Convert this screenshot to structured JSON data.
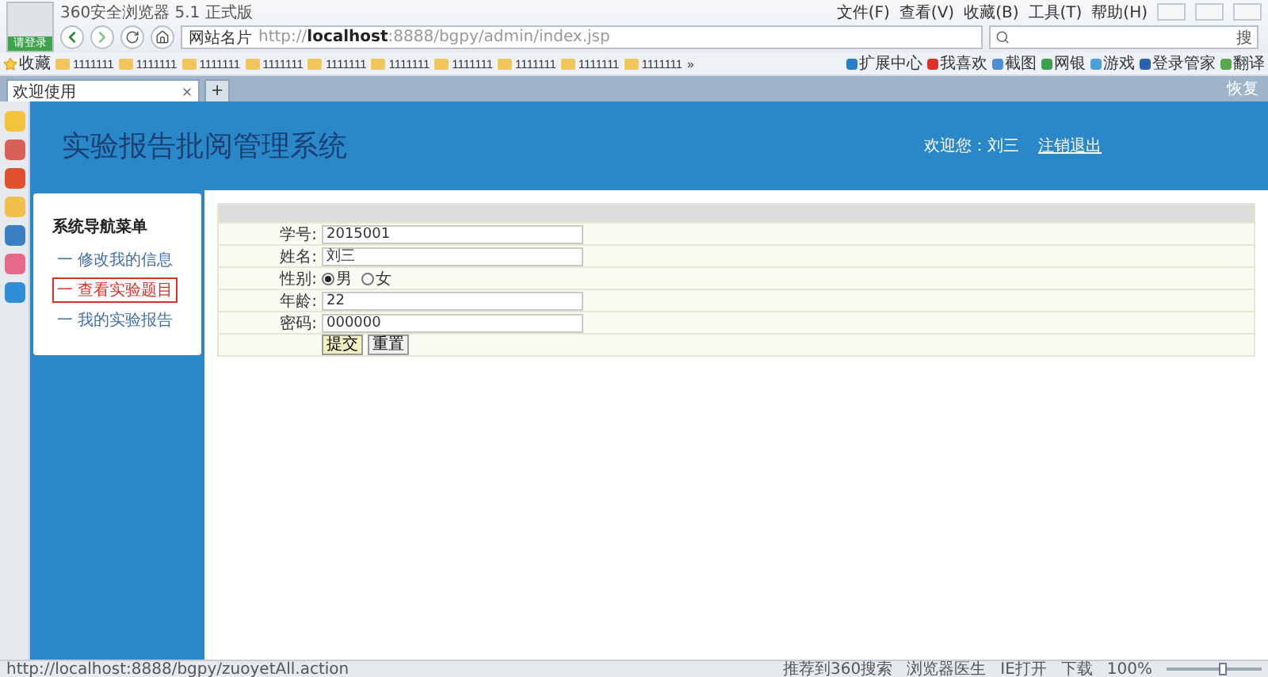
{
  "browser": {
    "title": "360安全浏览器 5.1 正式版",
    "login_label": "请登录",
    "menu": [
      "文件(F)",
      "查看(V)",
      "收藏(B)",
      "工具(T)",
      "帮助(H)"
    ],
    "site_name": "网站名片",
    "url_prefix": "http://",
    "url_host": "localhost",
    "url_rest": ":8888/bgpy/admin/index.jsp",
    "search_button": "搜",
    "favorites_label": "收藏",
    "bookmarks": [
      "1111111",
      "1111111",
      "1111111",
      "1111111",
      "1111111",
      "1111111",
      "1111111",
      "1111111",
      "1111111",
      "1111111"
    ],
    "more": "»",
    "tools": [
      "扩展中心",
      "我喜欢",
      "截图",
      "网银",
      "游戏",
      "登录管家",
      "翻译"
    ],
    "tabs": [
      {
        "label": "欢迎使用",
        "selected": true
      }
    ],
    "new_tab": "+",
    "restore_label": "恢复"
  },
  "page": {
    "title": "实验报告批阅管理系统",
    "welcome": "欢迎您：刘三",
    "logout": "注销退出",
    "nav": {
      "heading": "系统导航菜单",
      "items": [
        {
          "label": "一 修改我的信息",
          "selected": false
        },
        {
          "label": "一 查看实验题目",
          "selected": true
        },
        {
          "label": "一 我的实验报告",
          "selected": false
        }
      ]
    },
    "form": {
      "fields": [
        {
          "kind": "text",
          "label": "学号:",
          "value": "2015001"
        },
        {
          "kind": "text",
          "label": "姓名:",
          "value": "刘三"
        },
        {
          "kind": "radio",
          "label": "性别:",
          "options": [
            {
              "label": "男",
              "selected": true
            },
            {
              "label": "女",
              "selected": false
            }
          ]
        },
        {
          "kind": "text",
          "label": "年龄:",
          "value": "22"
        },
        {
          "kind": "text",
          "label": "密码:",
          "value": "000000"
        }
      ],
      "buttons": [
        "提交",
        "重置"
      ]
    }
  },
  "status_bar": {
    "url": "http://localhost:8888/bgpy/zuoyetAll.action",
    "items": [
      "推荐到360搜索",
      "浏览器医生",
      "IE打开",
      "下载"
    ],
    "zoom": "100%",
    "zoom_slider": {
      "level": 0.6
    }
  }
}
